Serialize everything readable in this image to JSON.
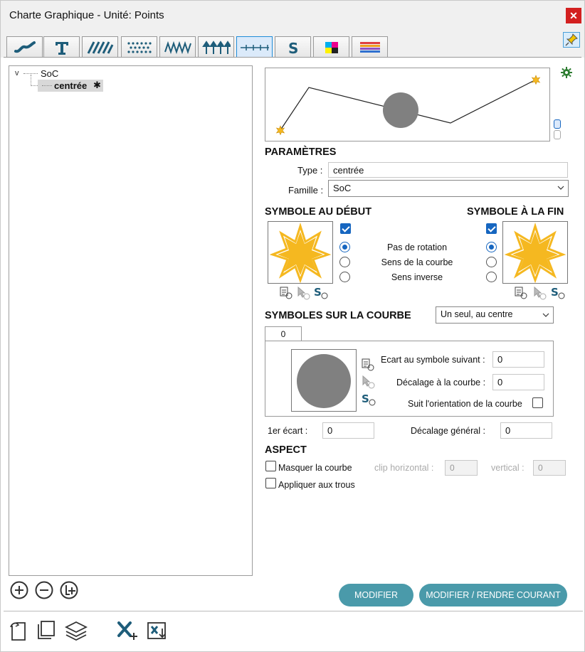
{
  "window": {
    "title": "Charte Graphique - Unité: Points",
    "close_label": "✕"
  },
  "tabs": [
    {
      "name": "curve"
    },
    {
      "name": "text"
    },
    {
      "name": "hatch"
    },
    {
      "name": "pattern"
    },
    {
      "name": "zigzag"
    },
    {
      "name": "arrows"
    },
    {
      "name": "symbols-line",
      "active": true
    },
    {
      "name": "s-style"
    },
    {
      "name": "colors"
    },
    {
      "name": "gradient"
    }
  ],
  "tree": {
    "root": "SoC",
    "child": "centrée"
  },
  "params": {
    "heading": "PARAMÈTRES",
    "type_label": "Type :",
    "type_value": "centrée",
    "family_label": "Famille :",
    "family_value": "SoC"
  },
  "start_symbol": {
    "heading": "SYMBOLE AU DÉBUT"
  },
  "end_symbol": {
    "heading": "SYMBOLE À LA FIN"
  },
  "rotation_options": [
    "Pas de rotation",
    "Sens de la courbe",
    "Sens inverse"
  ],
  "curve_symbols": {
    "heading": "SYMBOLES SUR LA COURBE",
    "mode_value": "Un seul, au centre",
    "tab_label": "0",
    "gap_label": "Ecart au symbole suivant :",
    "gap_value": "0",
    "offset_label": "Décalage à la courbe :",
    "offset_value": "0",
    "follow_label": "Suit l'orientation de la courbe",
    "first_gap_label": "1er écart :",
    "first_gap_value": "0",
    "general_offset_label": "Décalage général :",
    "general_offset_value": "0"
  },
  "aspect": {
    "heading": "ASPECT",
    "hide_curve_label": "Masquer la courbe",
    "clip_h_label": "clip horizontal :",
    "clip_h_value": "0",
    "vertical_label": "vertical :",
    "vertical_value": "0",
    "apply_holes_label": "Appliquer aux trous"
  },
  "buttons": {
    "modify": "MODIFIER",
    "modify_current": "MODIFIER / RENDRE COURANT"
  },
  "colors": {
    "accent": "#1666c0",
    "button": "#4a9aaa",
    "star": "#f5b820",
    "symbol": "#808080"
  }
}
